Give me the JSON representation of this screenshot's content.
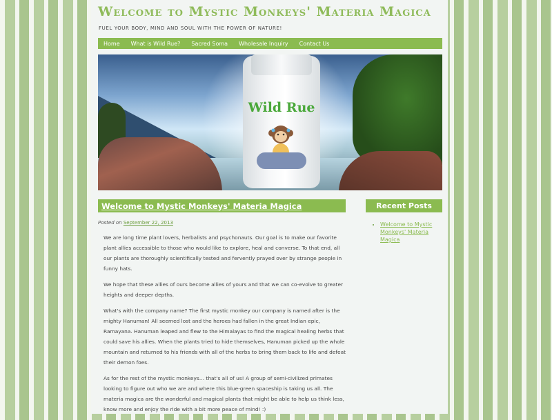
{
  "site": {
    "title": "Welcome to Mystic Monkeys' Materia Magica",
    "tagline": "Fuel your body, mind and soul with the power of nature!"
  },
  "nav": {
    "items": [
      {
        "label": "Home"
      },
      {
        "label": "What is Wild Rue?"
      },
      {
        "label": "Sacred Soma"
      },
      {
        "label": "Wholesale Inquiry"
      },
      {
        "label": "Contact Us"
      }
    ]
  },
  "banner": {
    "product_label": "Wild Rue"
  },
  "post": {
    "title": "Welcome to Mystic Monkeys' Materia Magica",
    "posted_prefix": "Posted on",
    "date": "September 22, 2013",
    "paragraphs": [
      "We are long time plant lovers, herbalists and psychonauts.  Our goal is to make our favorite plant allies accessible to those who would like to explore, heal and converse.  To that end, all our plants are thoroughly scientifically tested and fervently prayed over by strange people in funny hats.",
      "We hope that these allies of ours become allies of yours and that we can co-evolve to greater heights and deeper depths.",
      "What's with the company name?  The first mystic monkey our company is named after is the mighty Hanuman!  All seemed lost and the heroes had fallen in the great Indian epic, Ramayana.  Hanuman leaped and flew to the Himalayas to find the magical healing herbs that could save his allies.  When the plants tried to hide themselves, Hanuman picked up the whole mountain and returned to his friends with all of the herbs to bring them back to life and defeat their demon foes.",
      "As for the rest of the mystic monkeys… that's all of us!  A group of semi-civilized primates looking to figure out who we are and where this blue-green spaceship is taking us all.  The materia magica are the wonderful and magical plants that might be able to help us think less, know more and enjoy the ride with a bit more peace of mind!  :)"
    ]
  },
  "sidebar": {
    "recent_heading": "Recent Posts",
    "recent_items": [
      {
        "label": "Welcome to Mystic Monkeys' Materia Magica"
      }
    ]
  },
  "colors": {
    "accent_green": "#8bbb50",
    "title_green": "#8fbb5a"
  }
}
